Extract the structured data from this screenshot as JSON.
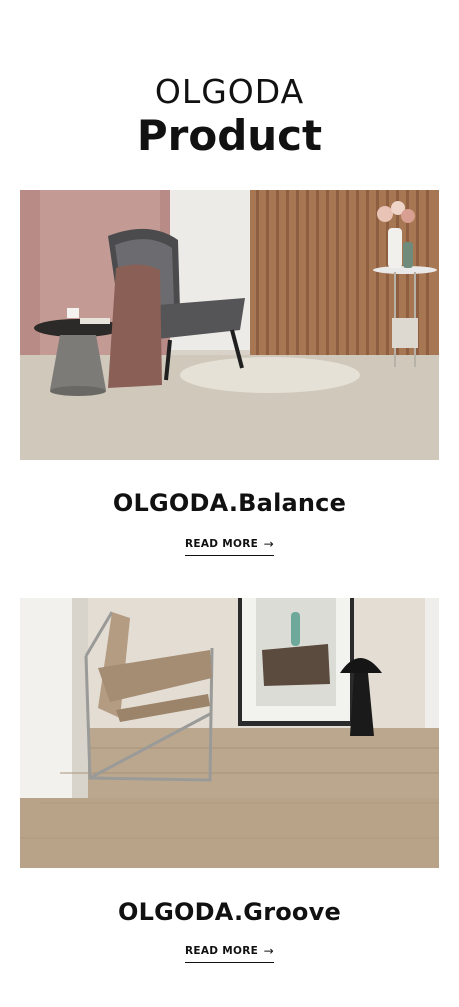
{
  "header": {
    "brand": "OLGODA",
    "title": "Product"
  },
  "products": [
    {
      "name": "OLGODA.Balance",
      "read_more": "READ MORE",
      "arrow": "→"
    },
    {
      "name": "OLGODA.Groove",
      "read_more": "READ MORE",
      "arrow": "→"
    }
  ]
}
